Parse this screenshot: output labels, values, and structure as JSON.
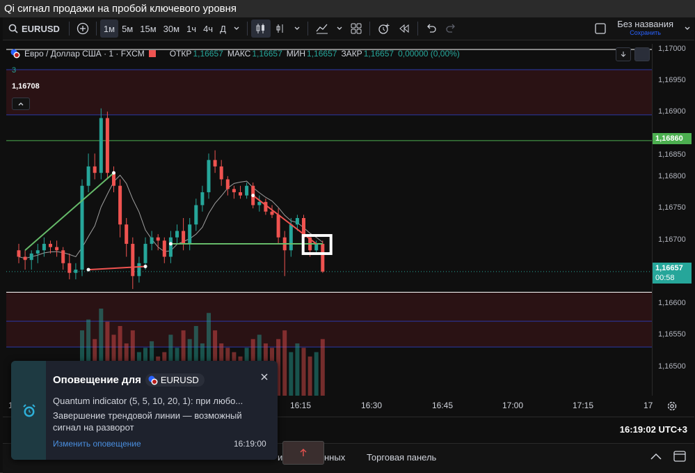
{
  "window": {
    "title": "Qi сигнал продажи на пробой ключевого уровня"
  },
  "toolbar": {
    "symbol": "EURUSD",
    "intervals": [
      "1м",
      "5м",
      "15м",
      "30м",
      "1ч",
      "4ч",
      "Д"
    ],
    "active_interval": "1м",
    "layout_name": "Без названия",
    "save_label": "Сохранить"
  },
  "legend": {
    "pair": "Евро / Доллар США · 1 · FXCM",
    "open_label": "ОТКР",
    "open": "1,16657",
    "high_label": "МАКС",
    "high": "1,16657",
    "low_label": "МИН",
    "low": "1,16657",
    "close_label": "ЗАКР",
    "close": "1,16657",
    "change": "0,00000 (0,00%)",
    "indicator_value": "3",
    "indicator_price": "1,16708"
  },
  "price_axis": {
    "ticks": [
      "1,17000",
      "1,16950",
      "1,16900",
      "1,16850",
      "1,16800",
      "1,16750",
      "1,16700",
      "1,16650",
      "1,16600",
      "1,16550",
      "1,16500"
    ],
    "level_tag": "1,16860",
    "last_price": "1,16657",
    "countdown": "00:58"
  },
  "time_axis": {
    "labels": [
      "16:15",
      "16:30",
      "16:45",
      "17:00",
      "17:15",
      "17"
    ],
    "partial_left": "1"
  },
  "status": {
    "clock": "16:19:02 UTC+3"
  },
  "bottom_panel": {
    "tab_partial": "нных",
    "trading_panel": "Торговая панель",
    "partial_left": "и"
  },
  "alert": {
    "title": "Оповещение для",
    "symbol": "EURUSD",
    "line1": "Quantum indicator (5, 5, 10, 20, 1): при любо...",
    "line2": "Завершение трендовой линии — возможный",
    "line3": "сигнал на разворот",
    "edit_link": "Изменить оповещение",
    "time": "16:19:00"
  },
  "colors": {
    "up": "#26a69a",
    "down": "#ef5350",
    "level": "#4caf50",
    "accent": "#2962ff"
  },
  "chart_data": {
    "type": "candlestick",
    "ylim": [
      1.1647,
      1.1701
    ],
    "candles": [
      {
        "o": 1.1669,
        "h": 1.167,
        "l": 1.1667,
        "c": 1.1668
      },
      {
        "o": 1.1668,
        "h": 1.1669,
        "l": 1.1666,
        "c": 1.16675
      },
      {
        "o": 1.16675,
        "h": 1.1669,
        "l": 1.1666,
        "c": 1.16685
      },
      {
        "o": 1.16685,
        "h": 1.167,
        "l": 1.1667,
        "c": 1.1669
      },
      {
        "o": 1.1669,
        "h": 1.1671,
        "l": 1.1668,
        "c": 1.167
      },
      {
        "o": 1.167,
        "h": 1.16705,
        "l": 1.16685,
        "c": 1.16695
      },
      {
        "o": 1.16695,
        "h": 1.16705,
        "l": 1.1668,
        "c": 1.1669
      },
      {
        "o": 1.1669,
        "h": 1.16695,
        "l": 1.1666,
        "c": 1.1667
      },
      {
        "o": 1.1667,
        "h": 1.16685,
        "l": 1.16645,
        "c": 1.16655
      },
      {
        "o": 1.16655,
        "h": 1.1667,
        "l": 1.16645,
        "c": 1.1666
      },
      {
        "o": 1.1666,
        "h": 1.168,
        "l": 1.1665,
        "c": 1.1679
      },
      {
        "o": 1.1679,
        "h": 1.1684,
        "l": 1.1678,
        "c": 1.1682
      },
      {
        "o": 1.1682,
        "h": 1.1684,
        "l": 1.168,
        "c": 1.1681
      },
      {
        "o": 1.1681,
        "h": 1.1691,
        "l": 1.168,
        "c": 1.16895
      },
      {
        "o": 1.16895,
        "h": 1.16905,
        "l": 1.168,
        "c": 1.1681
      },
      {
        "o": 1.1681,
        "h": 1.1682,
        "l": 1.1678,
        "c": 1.1679
      },
      {
        "o": 1.1679,
        "h": 1.168,
        "l": 1.1671,
        "c": 1.1673
      },
      {
        "o": 1.1673,
        "h": 1.1674,
        "l": 1.1668,
        "c": 1.167
      },
      {
        "o": 1.167,
        "h": 1.1671,
        "l": 1.1663,
        "c": 1.1665
      },
      {
        "o": 1.1665,
        "h": 1.1668,
        "l": 1.1664,
        "c": 1.1667
      },
      {
        "o": 1.1667,
        "h": 1.1671,
        "l": 1.1666,
        "c": 1.167
      },
      {
        "o": 1.167,
        "h": 1.1672,
        "l": 1.1669,
        "c": 1.1671
      },
      {
        "o": 1.1671,
        "h": 1.16715,
        "l": 1.1669,
        "c": 1.16705
      },
      {
        "o": 1.16705,
        "h": 1.1671,
        "l": 1.1667,
        "c": 1.1668
      },
      {
        "o": 1.1668,
        "h": 1.1672,
        "l": 1.1667,
        "c": 1.1671
      },
      {
        "o": 1.1671,
        "h": 1.1673,
        "l": 1.167,
        "c": 1.1672
      },
      {
        "o": 1.1672,
        "h": 1.1674,
        "l": 1.1669,
        "c": 1.167
      },
      {
        "o": 1.167,
        "h": 1.1674,
        "l": 1.1669,
        "c": 1.1673
      },
      {
        "o": 1.1673,
        "h": 1.1677,
        "l": 1.1672,
        "c": 1.1676
      },
      {
        "o": 1.1676,
        "h": 1.1679,
        "l": 1.1675,
        "c": 1.1678
      },
      {
        "o": 1.1678,
        "h": 1.1684,
        "l": 1.1677,
        "c": 1.1683
      },
      {
        "o": 1.1683,
        "h": 1.16845,
        "l": 1.1681,
        "c": 1.1682
      },
      {
        "o": 1.1682,
        "h": 1.1683,
        "l": 1.1679,
        "c": 1.168
      },
      {
        "o": 1.168,
        "h": 1.16805,
        "l": 1.16775,
        "c": 1.16785
      },
      {
        "o": 1.16785,
        "h": 1.1679,
        "l": 1.1677,
        "c": 1.1678
      },
      {
        "o": 1.1678,
        "h": 1.1679,
        "l": 1.1677,
        "c": 1.16775
      },
      {
        "o": 1.16775,
        "h": 1.16795,
        "l": 1.1677,
        "c": 1.1679
      },
      {
        "o": 1.1679,
        "h": 1.16795,
        "l": 1.16755,
        "c": 1.1676
      },
      {
        "o": 1.1676,
        "h": 1.16775,
        "l": 1.1675,
        "c": 1.16765
      },
      {
        "o": 1.16765,
        "h": 1.1677,
        "l": 1.16745,
        "c": 1.1675
      },
      {
        "o": 1.1675,
        "h": 1.1676,
        "l": 1.1674,
        "c": 1.16745
      },
      {
        "o": 1.16745,
        "h": 1.16755,
        "l": 1.167,
        "c": 1.1671
      },
      {
        "o": 1.1671,
        "h": 1.1672,
        "l": 1.1665,
        "c": 1.1669
      },
      {
        "o": 1.1669,
        "h": 1.1674,
        "l": 1.1668,
        "c": 1.1673
      },
      {
        "o": 1.1673,
        "h": 1.16745,
        "l": 1.1672,
        "c": 1.1674
      },
      {
        "o": 1.1674,
        "h": 1.16745,
        "l": 1.167,
        "c": 1.1671
      },
      {
        "o": 1.1671,
        "h": 1.16715,
        "l": 1.1668,
        "c": 1.1669
      },
      {
        "o": 1.1669,
        "h": 1.16705,
        "l": 1.16685,
        "c": 1.167
      },
      {
        "o": 1.167,
        "h": 1.16705,
        "l": 1.16655,
        "c": 1.16657
      }
    ],
    "volume": [
      8,
      6,
      7,
      6,
      9,
      5,
      7,
      9,
      10,
      8,
      30,
      35,
      26,
      40,
      34,
      28,
      32,
      24,
      30,
      20,
      22,
      25,
      18,
      20,
      28,
      22,
      30,
      26,
      32,
      24,
      38,
      30,
      24,
      22,
      20,
      18,
      22,
      26,
      28,
      24,
      22,
      26,
      30,
      20,
      24,
      22,
      18,
      20,
      26
    ],
    "horizontal_levels": [
      1.1686,
      1.16625
    ],
    "current_price": 1.16657
  }
}
